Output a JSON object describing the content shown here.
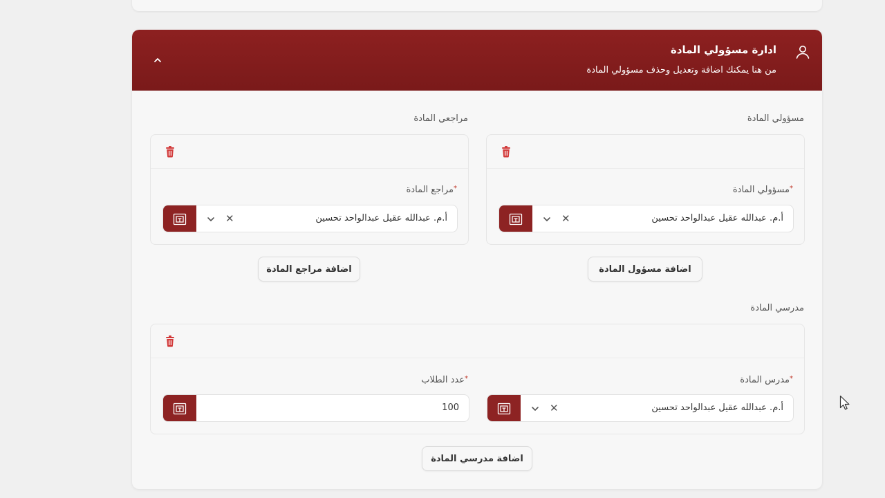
{
  "header": {
    "title": "ادارة مسؤولي المادة",
    "subtitle": "من هنا يمكنك اضافة وتعديل وحذف مسؤولي المادة",
    "icon": "user-icon",
    "toggle_icon": "chevron-up-icon"
  },
  "officials": {
    "section_label": "مسؤولي المادة",
    "field_label": "مسؤولي المادة",
    "value": "أ.م. عبدالله عقيل عبدالواحد تحسين",
    "add_label": "اضافة مسؤول المادة"
  },
  "reviewers": {
    "section_label": "مراجعي المادة",
    "field_label": "مراجع المادة",
    "value": "أ.م. عبدالله عقيل عبدالواحد تحسين",
    "add_label": "اضافة مراجع المادة"
  },
  "teachers": {
    "section_label": "مدرسي المادة",
    "teacher_label": "مدرس المادة",
    "teacher_value": "أ.م. عبدالله عقيل عبدالواحد تحسين",
    "students_label": "عدد الطلاب",
    "students_value": "100",
    "add_label": "اضافة مدرسي المادة"
  },
  "required_mark": "*",
  "clear_glyph": "✕",
  "colors": {
    "brand": "#8d2323",
    "trash": "#d23b3b",
    "background": "#f0f0f0"
  }
}
